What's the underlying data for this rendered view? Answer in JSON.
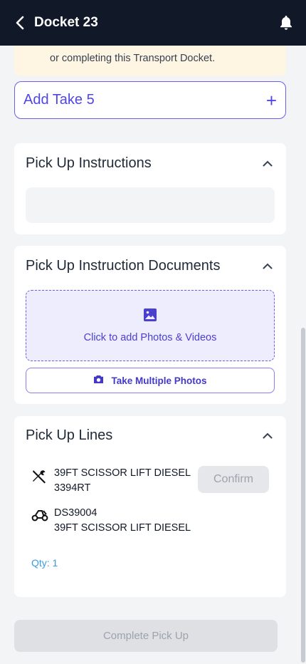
{
  "header": {
    "title": "Docket 23"
  },
  "warning": {
    "text": "or completing this Transport Docket."
  },
  "take5": {
    "label": "Add Take 5",
    "plus": "+"
  },
  "sections": {
    "instructions": {
      "title": "Pick Up Instructions"
    },
    "documents": {
      "title": "Pick Up Instruction Documents",
      "upload_label": "Click to add Photos & Videos",
      "multi_label": "Take Multiple Photos"
    },
    "lines": {
      "title": "Pick Up Lines",
      "items": [
        {
          "line1": "39FT SCISSOR LIFT DIESEL",
          "line2": "3394RT",
          "icon": "tools-icon"
        },
        {
          "line1": "DS39004",
          "line2": "39FT SCISSOR LIFT DIESEL",
          "icon": "vehicle-icon"
        }
      ],
      "confirm_label": "Confirm",
      "qty": "Qty: 1"
    }
  },
  "footer": {
    "complete_label": "Complete Pick Up"
  },
  "colors": {
    "accent": "#4f46e5",
    "header_bg": "#111827",
    "warning_bg": "#fef6e3",
    "qty": "#3b9be0"
  }
}
